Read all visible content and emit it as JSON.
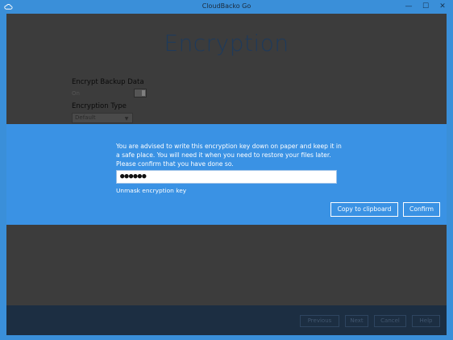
{
  "window": {
    "title": "CloudBacko Go",
    "controls": {
      "minimize": "—",
      "maximize": "☐",
      "close": "✕"
    }
  },
  "page": {
    "title": "Encryption",
    "encrypt_label": "Encrypt Backup Data",
    "toggle_state": "On",
    "type_label": "Encryption Type",
    "type_value": "Default"
  },
  "modal": {
    "message": "You are advised to write this encryption key down on paper and keep it in a safe place. You will need it when you need to restore your files later. Please confirm that you have done so.",
    "key_masked": "●●●●●●",
    "unmask_label": "Unmask encryption key",
    "copy_label": "Copy to clipboard",
    "confirm_label": "Confirm"
  },
  "footer": {
    "previous_label": "Previous",
    "next_label": "Next",
    "cancel_label": "Cancel",
    "help_label": "Help"
  },
  "colors": {
    "accent": "#3a92e4",
    "frame": "#3a8fd9",
    "footer": "#1c2e42",
    "overlay": "#3c3c3c"
  },
  "icons": {
    "app": "cloud-icon",
    "dropdown": "chevron-down-icon"
  }
}
